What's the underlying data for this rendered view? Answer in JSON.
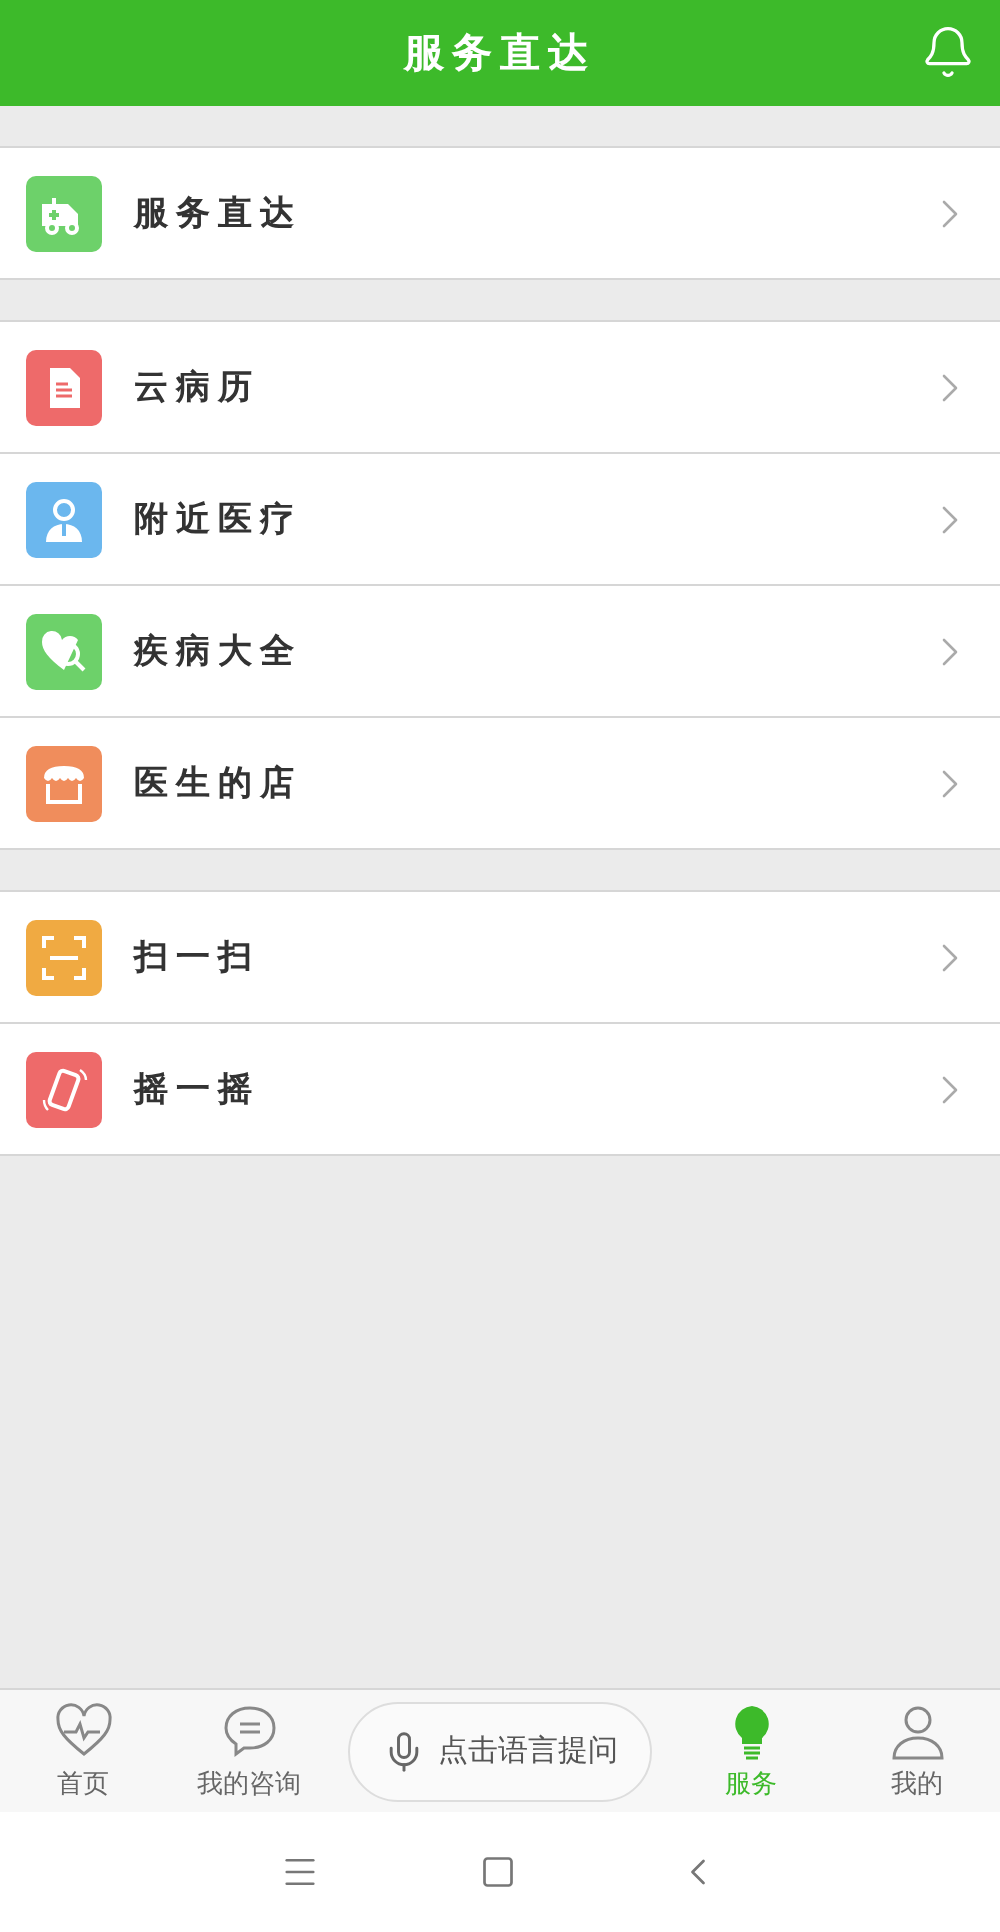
{
  "header": {
    "title": "服务直达"
  },
  "groups": [
    {
      "items": [
        {
          "label": "服务直达",
          "kind": "ambulance",
          "color": "#6dd16a"
        }
      ]
    },
    {
      "items": [
        {
          "label": "云病历",
          "kind": "document",
          "color": "#ee6a6a"
        },
        {
          "label": "附近医疗",
          "kind": "doctor",
          "color": "#6bb7ee"
        },
        {
          "label": "疾病大全",
          "kind": "heart-search",
          "color": "#6dd16a"
        },
        {
          "label": "医生的店",
          "kind": "store",
          "color": "#f08d5c"
        }
      ]
    },
    {
      "items": [
        {
          "label": "扫一扫",
          "kind": "scan",
          "color": "#f0aa42"
        },
        {
          "label": "摇一摇",
          "kind": "phone",
          "color": "#ee6a6a"
        }
      ]
    }
  ],
  "tabs": [
    {
      "label": "首页",
      "kind": "heart",
      "selected": false
    },
    {
      "label": "我的咨询",
      "kind": "chat",
      "selected": false
    },
    {
      "label": "点击语言提问",
      "kind": "voice",
      "selected": false
    },
    {
      "label": "服务",
      "kind": "bulb",
      "selected": true
    },
    {
      "label": "我的",
      "kind": "person",
      "selected": false
    }
  ]
}
